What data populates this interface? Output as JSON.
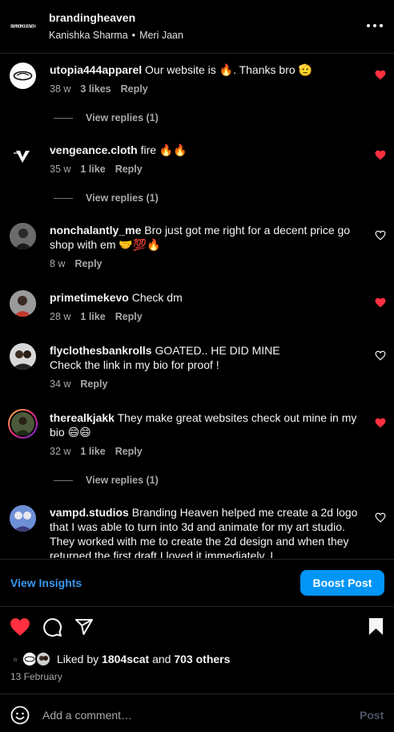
{
  "header": {
    "logo_icon": "brand-wordmark-icon",
    "username": "brandingheaven",
    "audio_artist": "Kanishka Sharma",
    "audio_separator": "•",
    "audio_track": "Meri Jaan",
    "more_icon": "more-horizontal-icon"
  },
  "comments": [
    {
      "username": "utopia444apparel",
      "text": "Our website is 🔥. Thanks bro 🫡",
      "time": "38 w",
      "likes": "3 likes",
      "reply": "Reply",
      "liked": true,
      "view_replies": "View replies (1)"
    },
    {
      "username": "vengeance.cloth",
      "text": "fire 🔥🔥",
      "time": "35 w",
      "likes": "1 like",
      "reply": "Reply",
      "liked": true,
      "view_replies": "View replies (1)"
    },
    {
      "username": "nonchalantly_me",
      "text": "Bro just got me right for a decent price go shop with em 🤝💯🔥",
      "time": "8 w",
      "likes": "",
      "reply": "Reply",
      "liked": false
    },
    {
      "username": "primetimekevo",
      "text": "Check dm",
      "time": "28 w",
      "likes": "1 like",
      "reply": "Reply",
      "liked": true
    },
    {
      "username": "flyclothesbankrolls",
      "text": "GOATED.. HE DID MINE",
      "text2": "Check the link in my bio for proof !",
      "time": "34 w",
      "likes": "",
      "reply": "Reply",
      "liked": false
    },
    {
      "username": "therealkjakk",
      "text": "They make great websites check out mine in my bio 😄😄",
      "time": "32 w",
      "likes": "1 like",
      "reply": "Reply",
      "liked": true,
      "view_replies": "View replies (1)"
    },
    {
      "username": "vampd.studios",
      "text": "Branding Heaven helped me create a 2d logo that I was able to turn into 3d and animate for my art studio. They worked with me to create the 2d design and when they returned the first draft I loved it immediately. I",
      "liked": false
    }
  ],
  "actions": {
    "view_insights": "View Insights",
    "boost_post": "Boost Post",
    "like_icon": "heart-filled-icon",
    "comment_icon": "comment-icon",
    "share_icon": "send-icon",
    "save_icon": "bookmark-filled-icon"
  },
  "likes": {
    "prefix": "Liked by",
    "user": "1804scat",
    "middle": "and",
    "others": "703 others"
  },
  "date": "13 February",
  "add_comment": {
    "emoji_icon": "emoji-icon",
    "placeholder": "Add a comment…",
    "post_label": "Post"
  },
  "colors": {
    "background": "#000000",
    "text": "#f5f5f5",
    "secondary": "#a8a8a8",
    "heart_red": "#ff3040",
    "accent_blue": "#0095f6",
    "link_blue": "#3797f0"
  }
}
